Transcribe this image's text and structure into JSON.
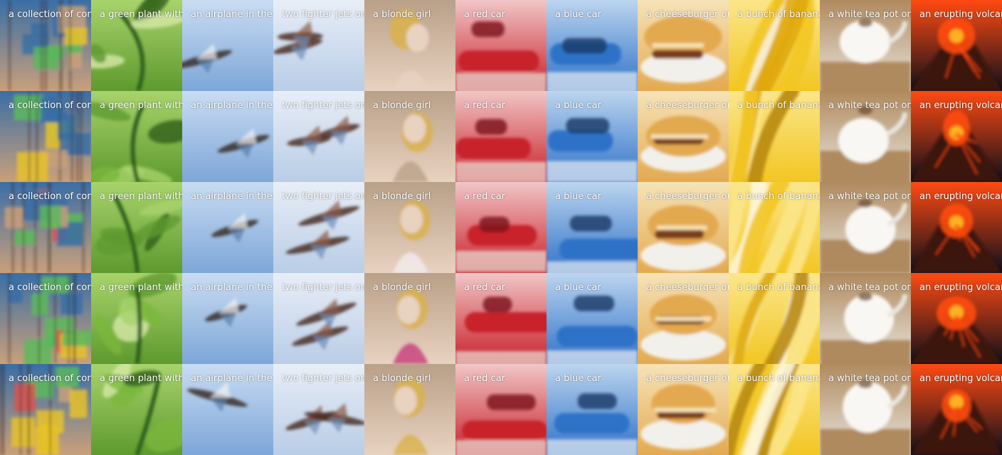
{
  "grid": {
    "rows": 5,
    "columns": [
      {
        "caption": "a collection of con",
        "subject": "comic-collage",
        "palette": [
          "#c9a07a",
          "#3a6ea5",
          "#d9534f",
          "#5cb85c",
          "#e6c229"
        ]
      },
      {
        "caption": "a green plant with",
        "subject": "green-plant",
        "palette": [
          "#5e9a2e",
          "#a8d36b",
          "#2f5f1a",
          "#d6eaa8",
          "#7bb83c"
        ]
      },
      {
        "caption": "an airplane in the",
        "subject": "airplane-sky",
        "palette": [
          "#7da6d8",
          "#c9dcf2",
          "#3a2e2a",
          "#f2f2f2",
          "#5a7ea8"
        ]
      },
      {
        "caption": "two fighter jets on",
        "subject": "fighter-jets",
        "palette": [
          "#b9cde6",
          "#e8eef7",
          "#4a2e24",
          "#8a5a44",
          "#6f8fb8"
        ]
      },
      {
        "caption": "a blonde girl",
        "subject": "blonde-girl",
        "palette": [
          "#e8d2c0",
          "#b9a088",
          "#f4ecf0",
          "#c83c7a",
          "#d9b24a"
        ]
      },
      {
        "caption": "a red car",
        "subject": "red-car",
        "palette": [
          "#c8202a",
          "#f1c6c6",
          "#7a1418",
          "#e9e3da",
          "#d65a3a"
        ]
      },
      {
        "caption": "a blue car",
        "subject": "blue-car",
        "palette": [
          "#2f72c8",
          "#bcd5ef",
          "#1c3a66",
          "#e9eef4",
          "#5b8fc8"
        ]
      },
      {
        "caption": "a cheeseburger or",
        "subject": "cheeseburger",
        "palette": [
          "#e3a950",
          "#f6e3b8",
          "#7a3c1e",
          "#f2f0ea",
          "#c67a2c"
        ]
      },
      {
        "caption": "a bunch of banana",
        "subject": "bananas",
        "palette": [
          "#f2c623",
          "#fbe68a",
          "#b88a12",
          "#fdf6dc",
          "#e0a810"
        ]
      },
      {
        "caption": "a white tea pot on",
        "subject": "tea-pot",
        "palette": [
          "#e9e6e0",
          "#b08a5e",
          "#f9f7f3",
          "#6b4a2c",
          "#cfc6b8"
        ]
      },
      {
        "caption": "an erupting volcar",
        "subject": "volcano",
        "palette": [
          "#0d0f1a",
          "#ff4a12",
          "#ffb020",
          "#3a1208",
          "#1b2740"
        ]
      }
    ]
  }
}
